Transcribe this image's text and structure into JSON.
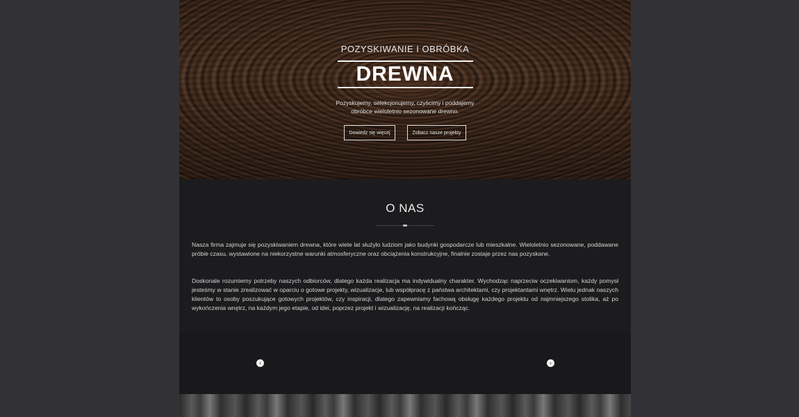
{
  "hero": {
    "subtitle": "POZYSKIWANIE I OBRÓBKA",
    "title": "DREWNA",
    "description": "Pozyskujemy, selekcjonujemy, czyścimy i poddajemy obróbce wieloletnio sezonowane drewno.",
    "buttons": [
      {
        "label": "Dowiedz się więcej"
      },
      {
        "label": "Zobacz nasze projekty"
      }
    ]
  },
  "about": {
    "title": "O NAS",
    "paragraphs": [
      "Nasza firma zajmuje się pozyskiwaniem drewna, które wiele lat służyło ludziom jako budynki gospodarcze lub mieszkalne. Wieloletnio sezonowane, poddawane próbie czasu, wystawione na niekorzystne warunki atmosferyczne oraz obciążenia konstrukcyjne, finalnie zostaje przez nas pozyskane.",
      "Doskonale rozumiemy potrzeby naszych odbiorców, dlatego każda realizacja ma indywidualny charakter. Wychodząc naprzeciw oczekiwaniom, każdy pomysł jesteśmy w stanie zrealizować w oparciu o gotowe projekty, wizualizacje, lub współpracę z państwa architektami, czy projektantami wnętrz. Wielu jednak naszych klientów to osoby poszukujące gotowych projektów, czy inspiracji, dlatego zapewniamy fachową obsługę każdego projektu od najmniejszego stolika, aż po wykończenia wnętrz, na każdym jego etapie, od idei, poprzez projekt i wizualizację, na realizacji kończąc."
    ]
  },
  "slider": {
    "prev_icon": "‹",
    "next_icon": "›"
  },
  "colors": {
    "background": "#323236",
    "panel": "#1e1e20",
    "text": "#d6d6d6"
  }
}
